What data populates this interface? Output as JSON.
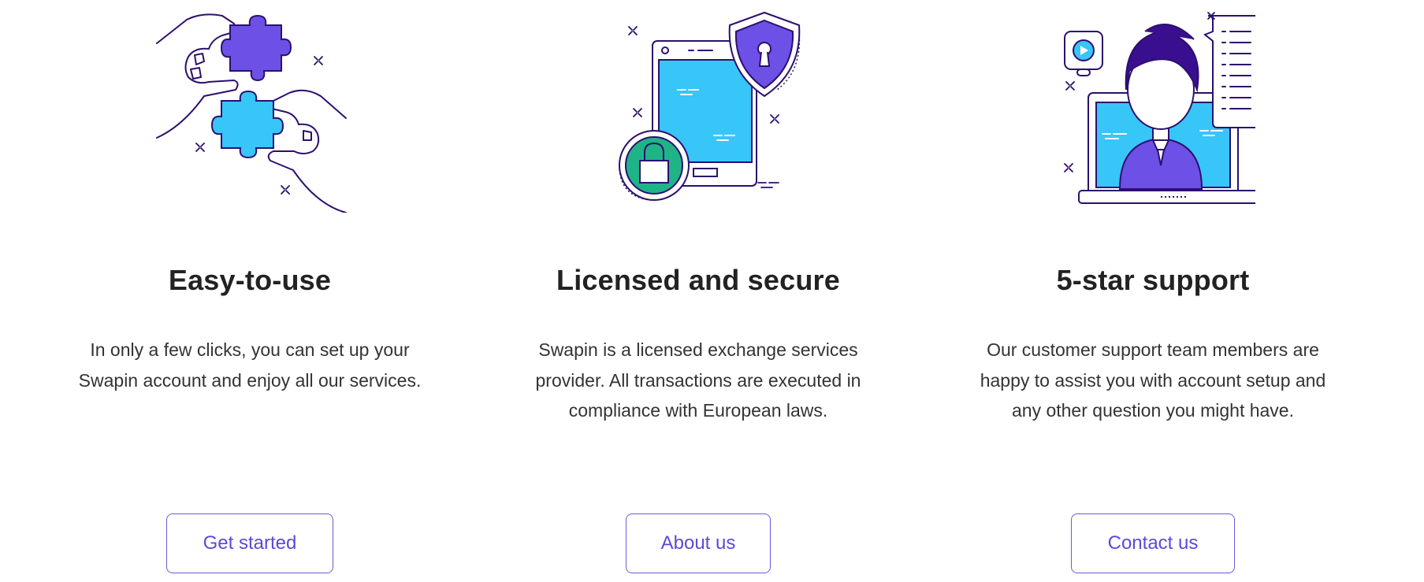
{
  "colors": {
    "accent": "#6a5be2",
    "outline": "#2d0f6e",
    "purple_fill": "#6d50e6",
    "cyan_fill": "#38c5f7",
    "green_fill": "#1fb487",
    "text": "#2b2b2b"
  },
  "features": [
    {
      "icon": "puzzle-pieces-icon",
      "title": "Easy-to-use",
      "description": "In only a few clicks, you can set up your Swapin account and enjoy all our services.",
      "button_label": "Get started"
    },
    {
      "icon": "secure-phone-shield-icon",
      "title": "Licensed and secure",
      "description": "Swapin is a licensed exchange services provider. All transactions are executed in compliance with European laws.",
      "button_label": "About us"
    },
    {
      "icon": "support-agent-icon",
      "title": "5-star support",
      "description": "Our customer support team members are happy to assist you with account setup and any other question you might have.",
      "button_label": "Contact us"
    }
  ]
}
